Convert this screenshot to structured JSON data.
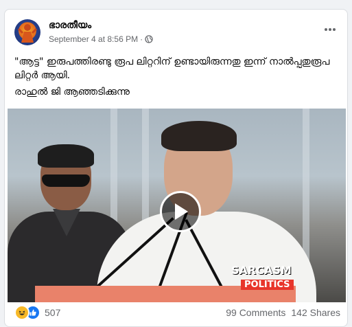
{
  "post": {
    "author": "ഭാരതീയം",
    "date": "September 4 at 8:56 PM",
    "separator": "·",
    "audience_icon": "globe-icon",
    "more_icon": "more-options-icon",
    "text_line1": "\"ആട്ട\"  ഇരുപത്തിരണ്ടു രൂപ ലിറ്ററിന് ഉണ്ടായിരുന്നതു ഇന്ന് നാൽപ്പതുരൂപ ലിറ്റർ ആയി.",
    "text_line2": "രാഹുൽ ജി ആഞ്ഞടിക്കുന്നു"
  },
  "video": {
    "play_icon": "play-icon",
    "watermark_line1": "SARCASM",
    "watermark_line2": "POLITICS"
  },
  "stats": {
    "reaction_icons": [
      "haha-icon",
      "like-icon"
    ],
    "reaction_count": "507",
    "comments": "99 Comments",
    "shares": "142 Shares"
  },
  "colors": {
    "like_blue": "#1877f2",
    "haha_yellow": "#f7b928",
    "watermark_red": "#e8352b",
    "meta_gray": "#65676b"
  }
}
